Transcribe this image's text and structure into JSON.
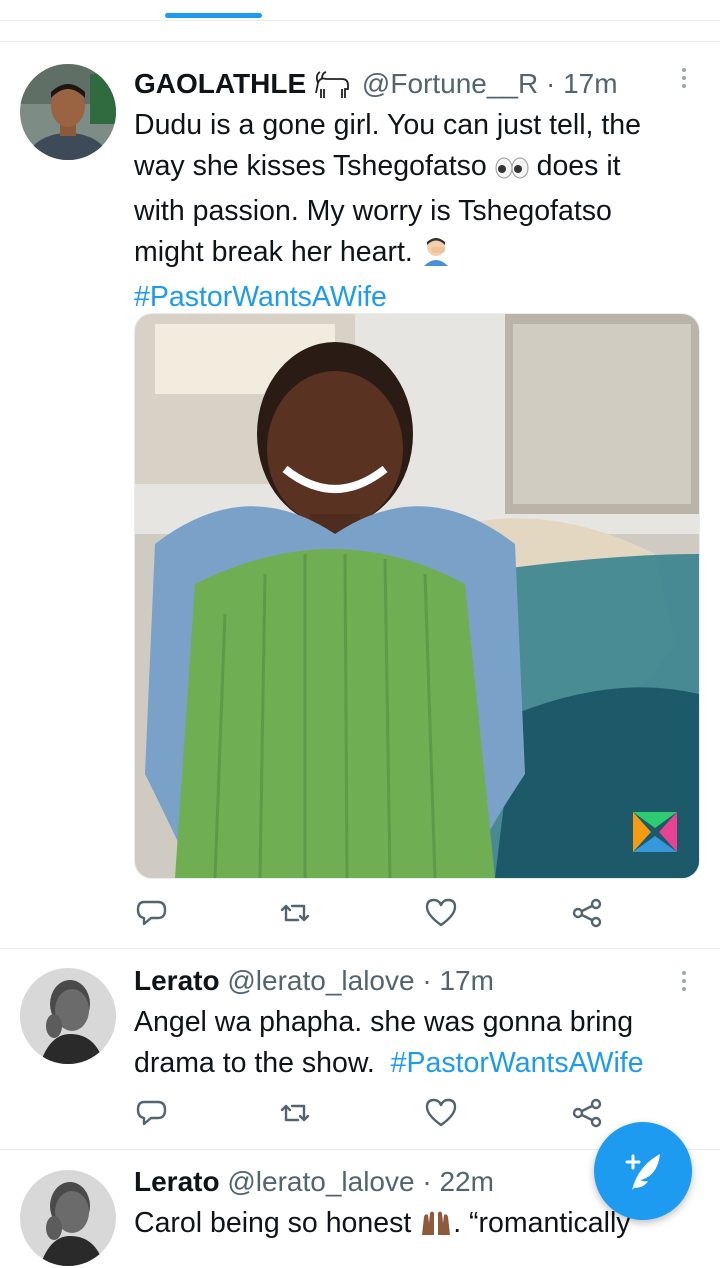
{
  "tweets": [
    {
      "name": "GAOLATHLE",
      "handle": "@Fortune__R",
      "separator": "·",
      "time": "17m",
      "text_lines": [
        "Dudu is a gone girl. You can just tell, the",
        "way she kisses Tshegofatso",
        "does it",
        "with passion. My worry is Tshegofatso",
        "might break her heart."
      ],
      "hashtag": "#PastorWantsAWife",
      "has_media": true
    },
    {
      "name": "Lerato",
      "handle": "@lerato_lalove",
      "separator": "·",
      "time": "17m",
      "text_lines": [
        "Angel wa phapha. she was gonna bring",
        "drama to the show."
      ],
      "hashtag": "#PastorWantsAWife"
    },
    {
      "name": "Lerato",
      "handle": "@lerato_lalove",
      "separator": "·",
      "time": "22m",
      "text_start": "Carol being so honest",
      "text_end": ". “romantically"
    }
  ],
  "icons": [
    "reply-icon",
    "retweet-icon",
    "like-icon",
    "share-icon",
    "more-icon",
    "compose-tweet-icon",
    "goat-emoji",
    "eyes-emoji",
    "facepalm-emoji",
    "raised-hands-emoji"
  ],
  "colors": {
    "accent": "#1d9bf0",
    "text": "#0f1419",
    "secondary": "#536471",
    "divider": "#e6ecf0"
  }
}
